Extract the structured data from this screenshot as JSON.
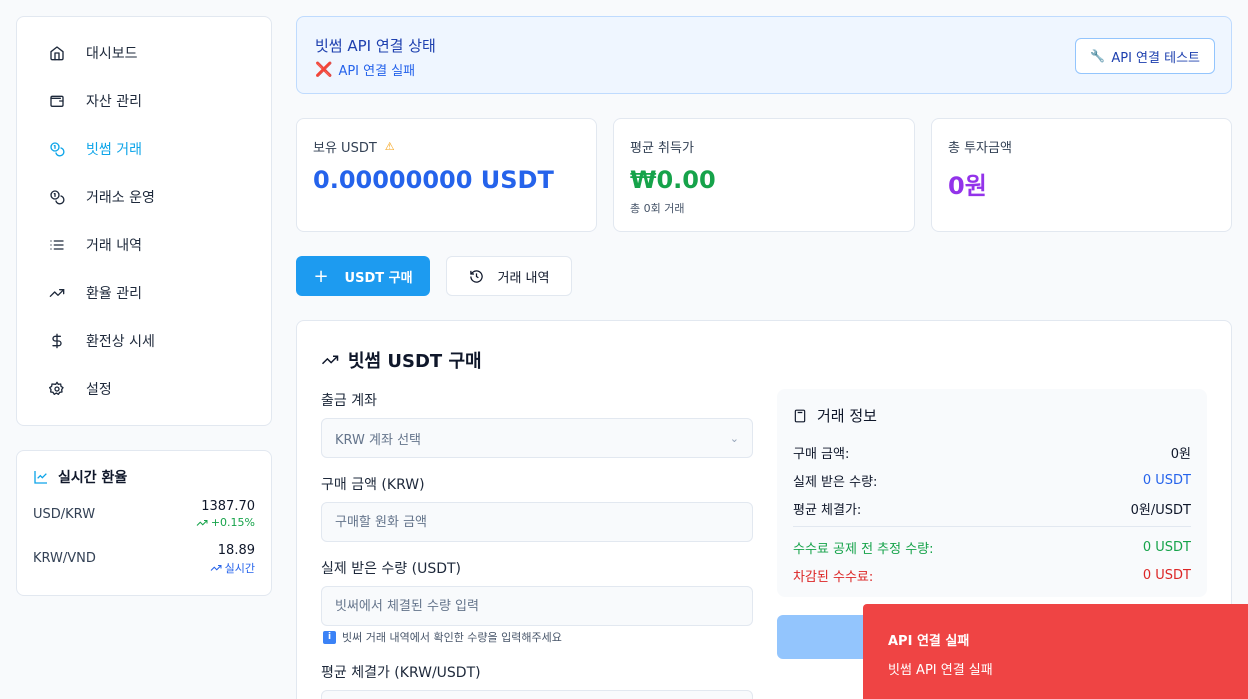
{
  "sidebar": {
    "items": [
      {
        "label": "대시보드",
        "icon": "home-icon"
      },
      {
        "label": "자산 관리",
        "icon": "wallet-icon"
      },
      {
        "label": "빗썸 거래",
        "icon": "coins-icon",
        "active": true
      },
      {
        "label": "거래소 운영",
        "icon": "coins-icon"
      },
      {
        "label": "거래 내역",
        "icon": "list-icon"
      },
      {
        "label": "환율 관리",
        "icon": "trending-up-icon"
      },
      {
        "label": "환전상 시세",
        "icon": "dollar-icon"
      },
      {
        "label": "설정",
        "icon": "gear-icon"
      }
    ]
  },
  "rates": {
    "title": "실시간 환율",
    "rows": [
      {
        "pair": "USD/KRW",
        "value": "1387.70",
        "sub": "+0.15%"
      },
      {
        "pair": "KRW/VND",
        "value": "18.89",
        "sub": "실시간"
      }
    ]
  },
  "api_status": {
    "title": "빗썸 API 연결 상태",
    "status": "API 연결 실패",
    "status_icon": "❌",
    "test_button": "API 연결 테스트"
  },
  "cards": {
    "usdt": {
      "label": "보유 USDT",
      "value": "0.00000000 USDT"
    },
    "avg": {
      "label": "평균 취득가",
      "value": "₩0.00",
      "sub": "총 0회 거래"
    },
    "total": {
      "label": "총 투자금액",
      "value": "0원"
    }
  },
  "actions": {
    "buy": "USDT 구매",
    "history": "거래 내역"
  },
  "form": {
    "title": "빗썸 USDT 구매",
    "account_label": "출금 계좌",
    "account_placeholder": "KRW 계좌 선택",
    "amount_label": "구매 금액 (KRW)",
    "amount_placeholder": "구매할 원화 금액",
    "qty_label": "실제 받은 수량 (USDT)",
    "qty_placeholder": "빗써에서 체결된 수량 입력",
    "qty_hint": "빗써 거래 내역에서 확인한 수량을 입력해주세요",
    "avg_label": "평균 체결가 (KRW/USDT)"
  },
  "trade_info": {
    "title": "거래 정보",
    "rows": [
      {
        "label": "구매 금액:",
        "value": "0원"
      },
      {
        "label": "실제 받은 수량:",
        "value": "0 USDT"
      },
      {
        "label": "평균 체결가:",
        "value": "0원/USDT"
      },
      {
        "label": "수수료 공제 전 추정 수량:",
        "value": "0 USDT"
      },
      {
        "label": "차감된 수수료:",
        "value": "0 USDT"
      }
    ]
  },
  "toast": {
    "title": "API 연결 실패",
    "message": "빗썸 API 연결 실패"
  },
  "colors": {
    "accent": "#1d9bf0",
    "primary_value": "#2563eb",
    "avg_value": "#16a34a",
    "total_value": "#9333ea",
    "error": "#ef4444"
  }
}
